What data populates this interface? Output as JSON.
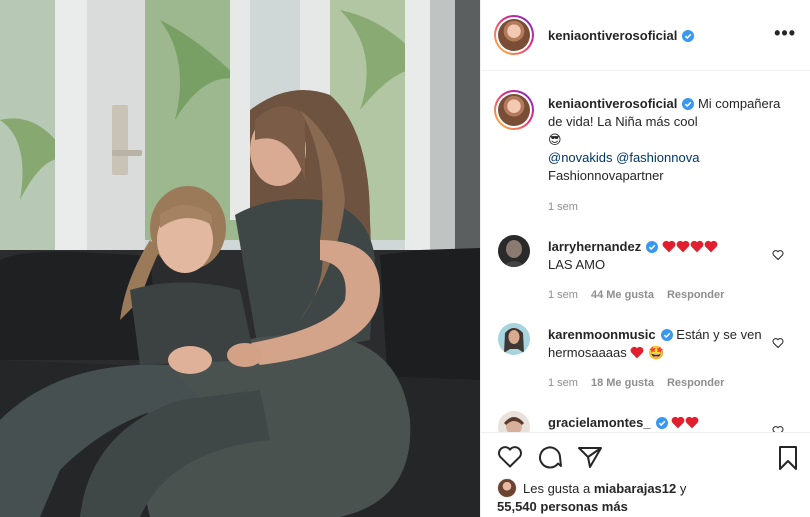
{
  "post": {
    "author": "keniaontiverosoficial",
    "caption": {
      "text_1": "Mi compañera de vida! La Niña más cool",
      "emoji": "😎",
      "mention_1": "@novakids",
      "mention_2": "@fashionnova",
      "text_2": "Fashionnovapartner",
      "time": "1 sem"
    }
  },
  "header": {
    "username": "keniaontiverosoficial",
    "more_label": "•••"
  },
  "comments": [
    {
      "username": "larryhernandez",
      "text": "LAS AMO",
      "time": "1 sem",
      "likes": "44 Me gusta",
      "reply": "Responder"
    },
    {
      "username": "karenmoonmusic",
      "text": "Están y se ven hermosaaaas",
      "emoji": "🤩",
      "time": "1 sem",
      "likes": "18 Me gusta",
      "reply": "Responder"
    },
    {
      "username": "gracielamontes_"
    }
  ],
  "likes": {
    "prefix": "Les gusta a",
    "user": "miabarajas12",
    "conj": "y",
    "others": "55,540 personas más"
  },
  "colors": {
    "verified": "#3897f0",
    "heart_red": "#ed4956",
    "mention": "#00376b",
    "muted": "#8e8e8e"
  },
  "icons": [
    "verified-icon",
    "heart-icon",
    "comment-icon",
    "share-icon",
    "bookmark-icon",
    "more-icon"
  ]
}
